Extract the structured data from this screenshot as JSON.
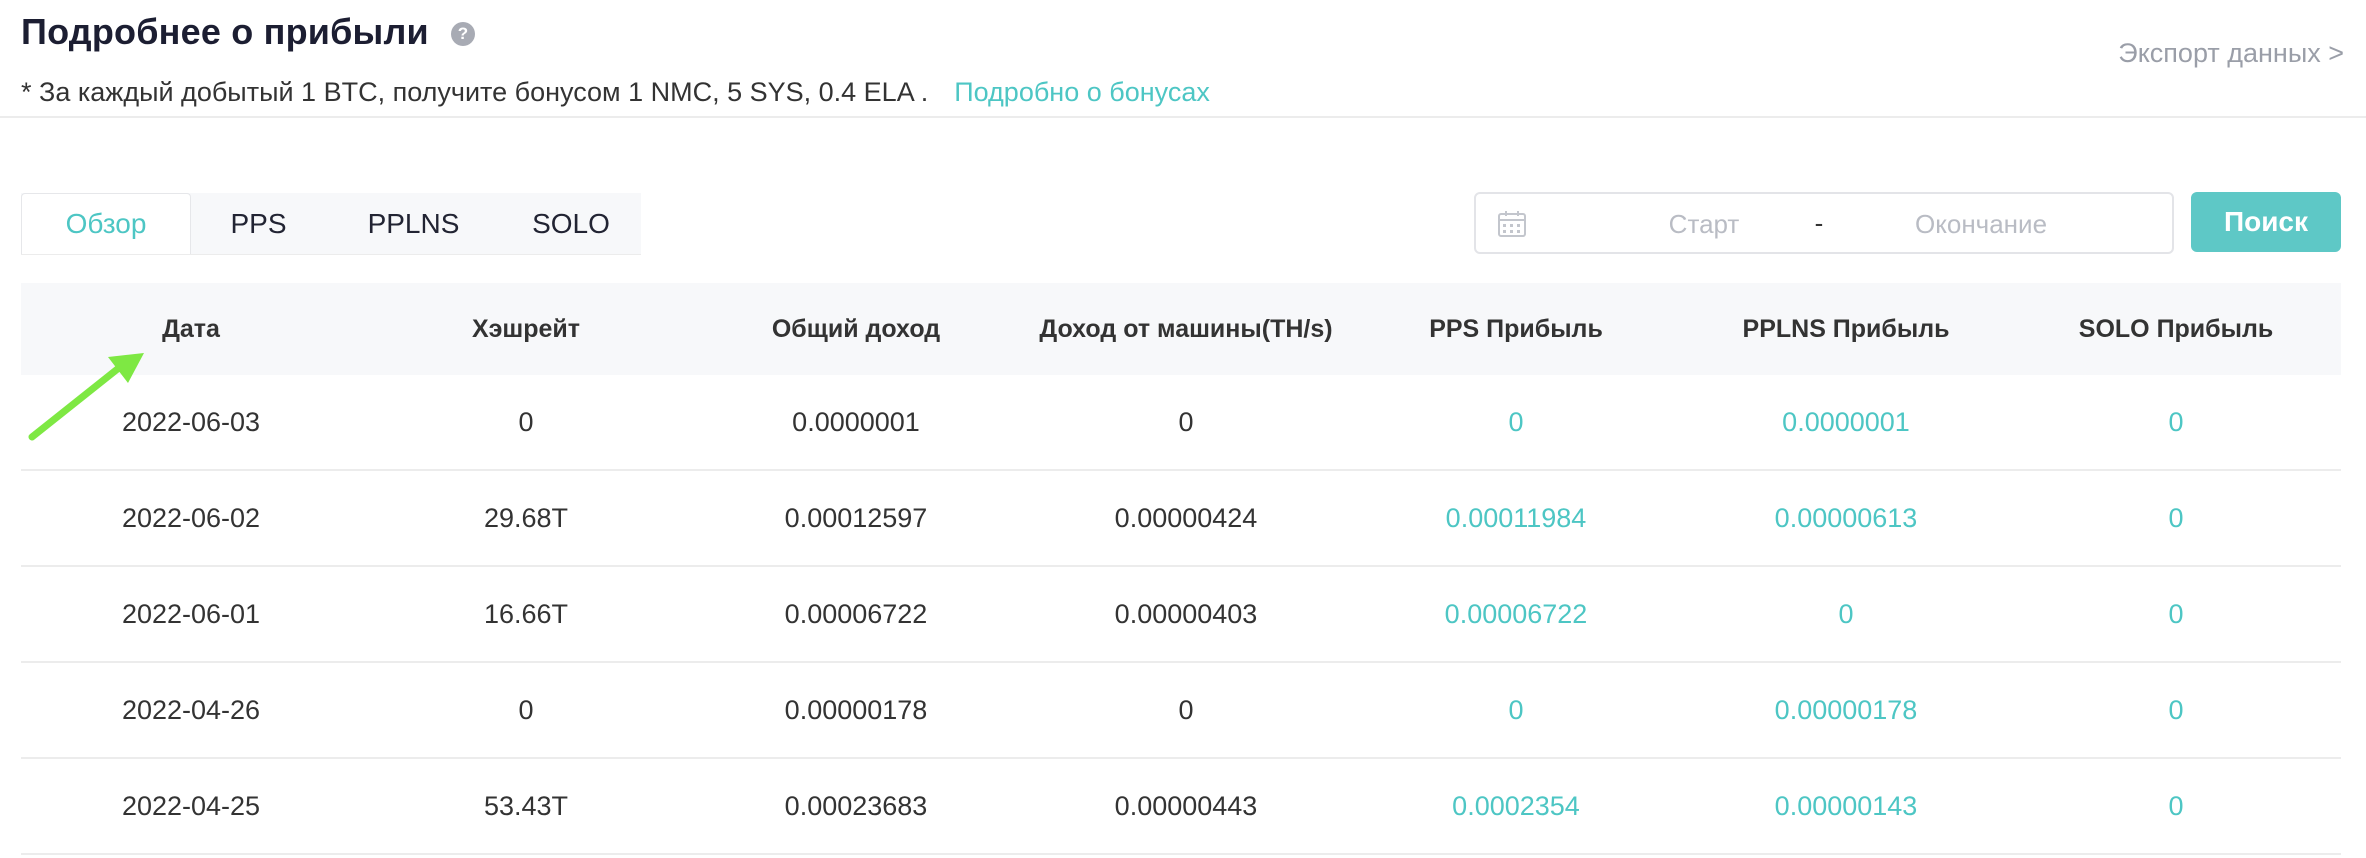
{
  "header": {
    "title": "Подробнее о прибыли",
    "help_icon": "?",
    "bonus_text": "* За каждый добытый 1 BTC, получите бонусом 1 NMC, 5 SYS, 0.4 ELA .",
    "bonus_link": "Подробно о бонусах",
    "export_link": "Экспорт данных >"
  },
  "tabs": [
    {
      "label": "Обзор",
      "active": true
    },
    {
      "label": "PPS",
      "active": false
    },
    {
      "label": "PPLNS",
      "active": false
    },
    {
      "label": "SOLO",
      "active": false
    }
  ],
  "date_filter": {
    "start_placeholder": "Старт",
    "separator": "-",
    "end_placeholder": "Окончание",
    "calendar_icon": "calendar-icon"
  },
  "search_button": "Поиск",
  "table": {
    "columns": [
      "Дата",
      "Хэшрейт",
      "Общий доход",
      "Доход от машины(TH/s)",
      "PPS Прибыль",
      "PPLNS Прибыль",
      "SOLO Прибыль"
    ],
    "rows": [
      [
        "2022-06-03",
        "0",
        "0.0000001",
        "0",
        "0",
        "0.0000001",
        "0"
      ],
      [
        "2022-06-02",
        "29.68T",
        "0.00012597",
        "0.00000424",
        "0.00011984",
        "0.00000613",
        "0"
      ],
      [
        "2022-06-01",
        "16.66T",
        "0.00006722",
        "0.00000403",
        "0.00006722",
        "0",
        "0"
      ],
      [
        "2022-04-26",
        "0",
        "0.00000178",
        "0",
        "0",
        "0.00000178",
        "0"
      ],
      [
        "2022-04-25",
        "53.43T",
        "0.00023683",
        "0.00000443",
        "0.0002354",
        "0.00000143",
        "0"
      ]
    ]
  },
  "colors": {
    "accent": "#4dc6c4",
    "button": "#5ec8c6",
    "arrow": "#7ee843",
    "title": "#1c1e32",
    "muted": "#9a9ea8"
  }
}
